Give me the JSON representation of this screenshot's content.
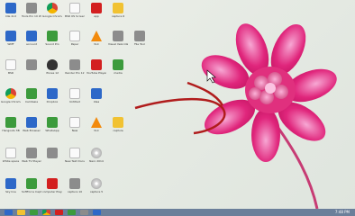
{
  "desktop": {
    "icons": [
      {
        "label": "Idle 2nd",
        "color": "g-blue"
      },
      {
        "label": "Tools Pro 10 Window",
        "color": "g-grey"
      },
      {
        "label": "Google Chrome",
        "color": "g-chrome"
      },
      {
        "label": "BSR OS Screen",
        "color": "g-white"
      },
      {
        "label": "app",
        "color": "g-red"
      },
      {
        "label": "capture 6",
        "color": "g-yellow"
      },
      {
        "label": "WMF",
        "color": "g-blue"
      },
      {
        "label": "account",
        "color": "g-blue"
      },
      {
        "label": "Sound Pro",
        "color": "g-green"
      },
      {
        "label": "Paper",
        "color": "g-white"
      },
      {
        "label": "VLC",
        "color": "g-cone"
      },
      {
        "label": "Visual Velocidad",
        "color": "g-grey"
      },
      {
        "label": "File Tool",
        "color": "g-grey"
      },
      {
        "label": "BSR",
        "color": "g-white"
      },
      {
        "label": "",
        "color": "g-grey"
      },
      {
        "label": "iTunes 12",
        "color": "g-apple"
      },
      {
        "label": "Render Pro 12",
        "color": "g-grey"
      },
      {
        "label": "YouTube Player",
        "color": "g-red"
      },
      {
        "label": "media",
        "color": "g-green"
      },
      {
        "label": "Google Chrome",
        "color": "g-chrome"
      },
      {
        "label": "Camtasia",
        "color": "g-green"
      },
      {
        "label": "Dropbox",
        "color": "g-blue"
      },
      {
        "label": "Untitled",
        "color": "g-white"
      },
      {
        "label": "Idea",
        "color": "g-blue"
      },
      {
        "label": "Hangouts 3B",
        "color": "g-green"
      },
      {
        "label": "Web Browser",
        "color": "g-blue"
      },
      {
        "label": "WhatsApp",
        "color": "g-green"
      },
      {
        "label": "New",
        "color": "g-white"
      },
      {
        "label": "VLC",
        "color": "g-cone"
      },
      {
        "label": "capture",
        "color": "g-yellow"
      },
      {
        "label": "White space",
        "color": "g-white"
      },
      {
        "label": "Web TV Player",
        "color": "g-grey"
      },
      {
        "label": "",
        "color": "g-grey"
      },
      {
        "label": "New Text Document",
        "color": "g-white"
      },
      {
        "label": "Nero 2014",
        "color": "g-disc"
      },
      {
        "label": "Sky line",
        "color": "g-blue"
      },
      {
        "label": "SoftForce Capture",
        "color": "g-green"
      },
      {
        "label": "computer Player",
        "color": "g-red"
      },
      {
        "label": "capture 10",
        "color": "g-grey"
      },
      {
        "label": "capture 5",
        "color": "g-disc"
      }
    ]
  },
  "taskbar": {
    "items": [
      "g-blue",
      "g-yellow",
      "g-green",
      "g-chrome",
      "g-red",
      "g-green",
      "g-grey",
      "g-blue"
    ],
    "clock": "7:48 PM"
  }
}
